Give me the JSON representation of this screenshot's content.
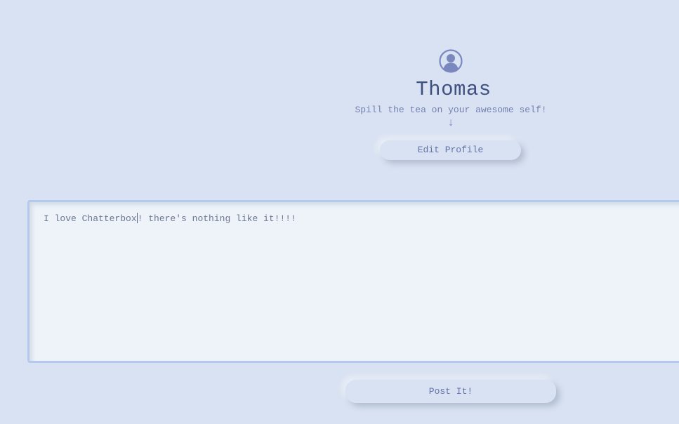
{
  "profile": {
    "avatar_icon": "user-circle-icon",
    "name": "Thomas",
    "tagline": "Spill the tea on your awesome self!",
    "arrow": "↓",
    "edit_button_label": "Edit Profile"
  },
  "composer": {
    "text_before_caret": "I love Chatterbox",
    "text_after_caret": "! there's nothing like it!!!!",
    "post_button_label": "Post It!"
  },
  "colors": {
    "background": "#d9e2f2",
    "accent": "#3f5080",
    "muted_text": "#7481b0",
    "textarea_border": "#b4c9ee",
    "textarea_bg": "#eef3f9"
  }
}
